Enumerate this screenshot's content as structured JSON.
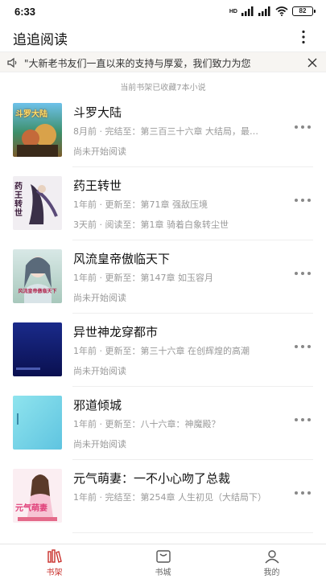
{
  "status": {
    "time": "6:33",
    "network": "HD",
    "battery": "82"
  },
  "app": {
    "title": "追追阅读"
  },
  "notice": {
    "text": "\"大新老书友们一直以来的支持与厚爱，我们致力为您"
  },
  "shelf": {
    "count_text": "当前书架已收藏7本小说"
  },
  "books": [
    {
      "title": "斗罗大陆",
      "meta": "8月前 · 完结至：第三百三十六章 大结局，最…",
      "read": "尚未开始阅读",
      "cover_text": "斗罗大陆"
    },
    {
      "title": "药王转世",
      "meta": "1年前 · 更新至：第71章 强敌压境",
      "read": "3天前 · 阅读至：第1章 骑着白象转尘世",
      "cover_text": "药王转世"
    },
    {
      "title": "风流皇帝傲临天下",
      "meta": "1年前 · 更新至：第147章 如玉容月",
      "read": "尚未开始阅读",
      "cover_text": "风流皇帝傲临天下"
    },
    {
      "title": "异世神龙穿都市",
      "meta": "1年前 · 更新至：第三十六章 在创辉煌的高潮",
      "read": "尚未开始阅读",
      "cover_text": ""
    },
    {
      "title": "邪道倾城",
      "meta": "1年前 · 更新至：八十六章：神魔殿？",
      "read": "尚未开始阅读",
      "cover_text": ""
    },
    {
      "title": "元气萌妻：一不小心吻了总裁",
      "meta": "1年前 · 完结至：第254章 人生初见（大结局下）",
      "read": "",
      "cover_text": "元气萌妻"
    }
  ],
  "nav": [
    {
      "label": "书架",
      "icon": "bookshelf-icon",
      "active": true
    },
    {
      "label": "书城",
      "icon": "bookstore-icon",
      "active": false
    },
    {
      "label": "我的",
      "icon": "profile-icon",
      "active": false
    }
  ],
  "colors": {
    "accent": "#c9302c",
    "muted": "#999999"
  }
}
